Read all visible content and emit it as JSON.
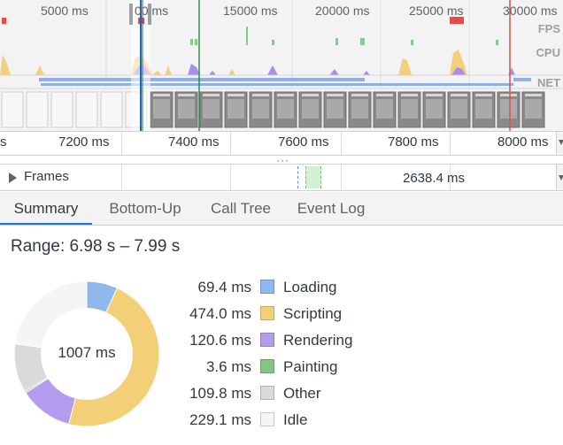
{
  "overview": {
    "time_ticks": [
      "5000 ms",
      "00 ms",
      "15000 ms",
      "20000 ms",
      "25000 ms",
      "30000 ms"
    ],
    "track_labels": {
      "fps": "FPS",
      "cpu": "CPU",
      "net": "NET"
    },
    "colors": {
      "fps_bad": "#e64a4a",
      "fps_ok": "#7fcf7f",
      "scripting": "#f2cf7a",
      "rendering": "#a88ee8",
      "network": "#8fb0e6",
      "selection_line": "#1f6aa5",
      "cursor_line": "#2e8b57",
      "end_line": "#d9534f"
    }
  },
  "ruler": {
    "ticks": [
      "s",
      "7200 ms",
      "7400 ms",
      "7600 ms",
      "7800 ms",
      "8000 ms"
    ]
  },
  "splitter": {
    "grip": "···"
  },
  "frames": {
    "label": "Frames",
    "duration": "2638.4 ms"
  },
  "tabs": [
    {
      "label": "Summary",
      "active": true
    },
    {
      "label": "Bottom-Up",
      "active": false
    },
    {
      "label": "Call Tree",
      "active": false
    },
    {
      "label": "Event Log",
      "active": false
    }
  ],
  "summary": {
    "range": "Range: 6.98 s – 7.99 s",
    "total": "1007 ms",
    "categories": [
      {
        "value": "69.4 ms",
        "name": "Loading",
        "ms": 69.4,
        "color": "#8fb8ee"
      },
      {
        "value": "474.0 ms",
        "name": "Scripting",
        "ms": 474.0,
        "color": "#f3cf78"
      },
      {
        "value": "120.6 ms",
        "name": "Rendering",
        "ms": 120.6,
        "color": "#b39cee"
      },
      {
        "value": "3.6 ms",
        "name": "Painting",
        "ms": 3.6,
        "color": "#85c484"
      },
      {
        "value": "109.8 ms",
        "name": "Other",
        "ms": 109.8,
        "color": "#dadada"
      },
      {
        "value": "229.1 ms",
        "name": "Idle",
        "ms": 229.1,
        "color": "#f5f5f5"
      }
    ]
  }
}
